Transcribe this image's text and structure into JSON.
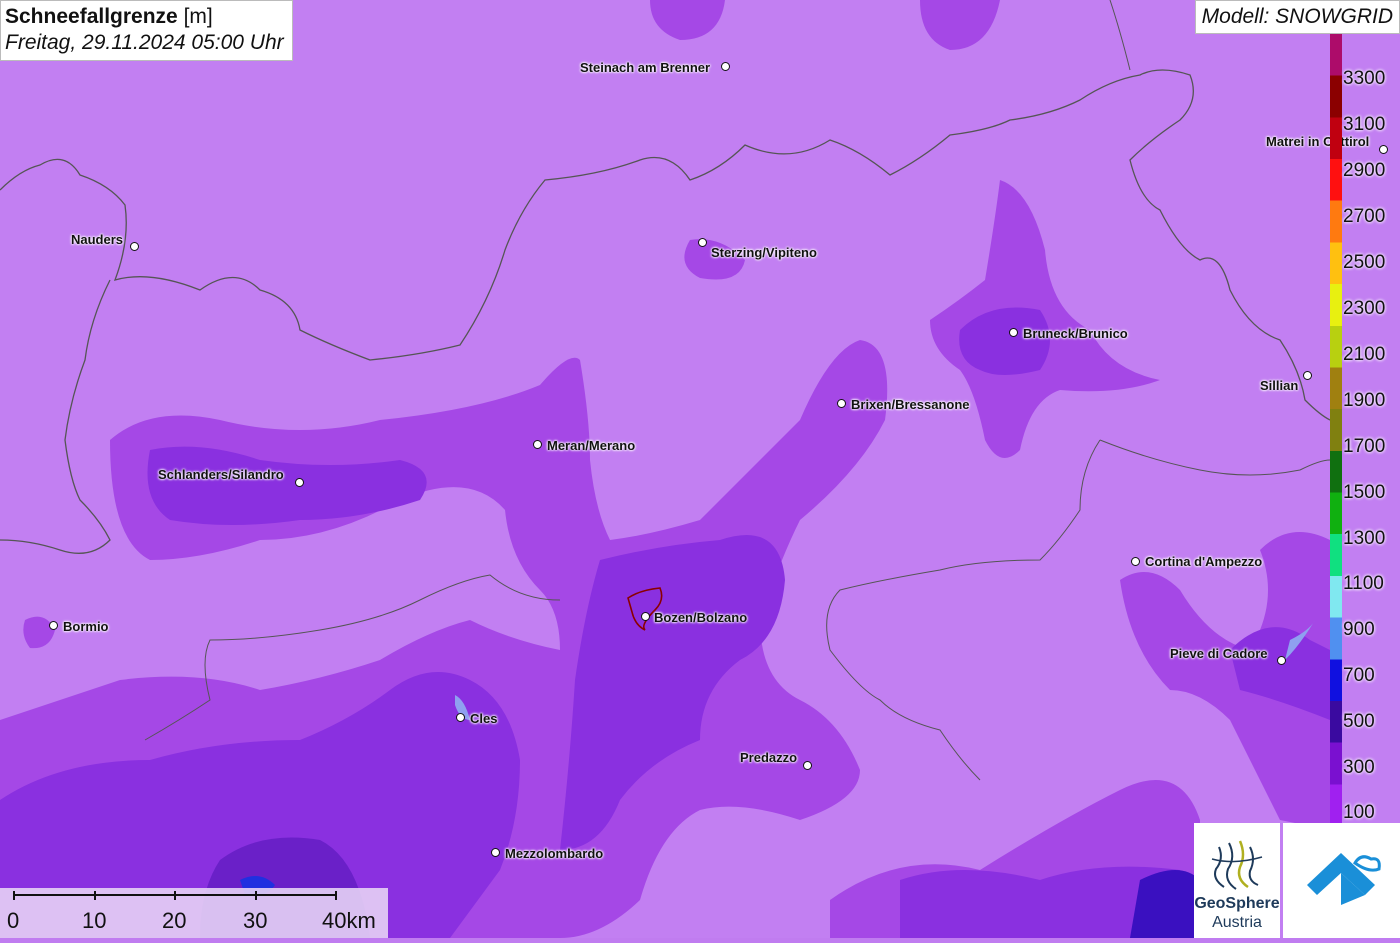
{
  "title": {
    "parameter": "Schneefallgrenze",
    "unit": "[m]",
    "datetime": "Freitag, 29.11.2024 05:00 Uhr"
  },
  "model": "Modell: SNOWGRID",
  "legend": {
    "labels": [
      "3300",
      "3100",
      "2900",
      "2700",
      "2500",
      "2300",
      "2100",
      "1900",
      "1700",
      "1500",
      "1300",
      "1100",
      "900",
      "700",
      "500",
      "300",
      "100"
    ],
    "colors": [
      "#ad0c6a",
      "#8b0000",
      "#c00010",
      "#ff1010",
      "#ff7a10",
      "#ffc010",
      "#e8f010",
      "#b8d010",
      "#a08010",
      "#808010",
      "#107010",
      "#10b010",
      "#10e080",
      "#80e8f0",
      "#5090f0",
      "#1010e0",
      "#3a0aa0",
      "#7a10d0",
      "#a020f0"
    ]
  },
  "scale": {
    "labels": [
      "0",
      "10",
      "20",
      "30",
      "40km"
    ]
  },
  "cities": [
    {
      "name": "Steinach am Brenner"
    },
    {
      "name": "Nauders"
    },
    {
      "name": "Sterzing/Vipiteno"
    },
    {
      "name": "Matrei in Osttirol"
    },
    {
      "name": "Bruneck/Brunico"
    },
    {
      "name": "Sillian"
    },
    {
      "name": "Brixen/Bressanone"
    },
    {
      "name": "Meran/Merano"
    },
    {
      "name": "Schlanders/Silandro"
    },
    {
      "name": "Cortina d'Ampezzo"
    },
    {
      "name": "Bozen/Bolzano"
    },
    {
      "name": "Bormio"
    },
    {
      "name": "Pieve di Cadore"
    },
    {
      "name": "Cles"
    },
    {
      "name": "Predazzo"
    },
    {
      "name": "Mezzolombardo"
    }
  ],
  "logos": {
    "geosphere_line1": "GeoSphere",
    "geosphere_line2": "Austria"
  }
}
